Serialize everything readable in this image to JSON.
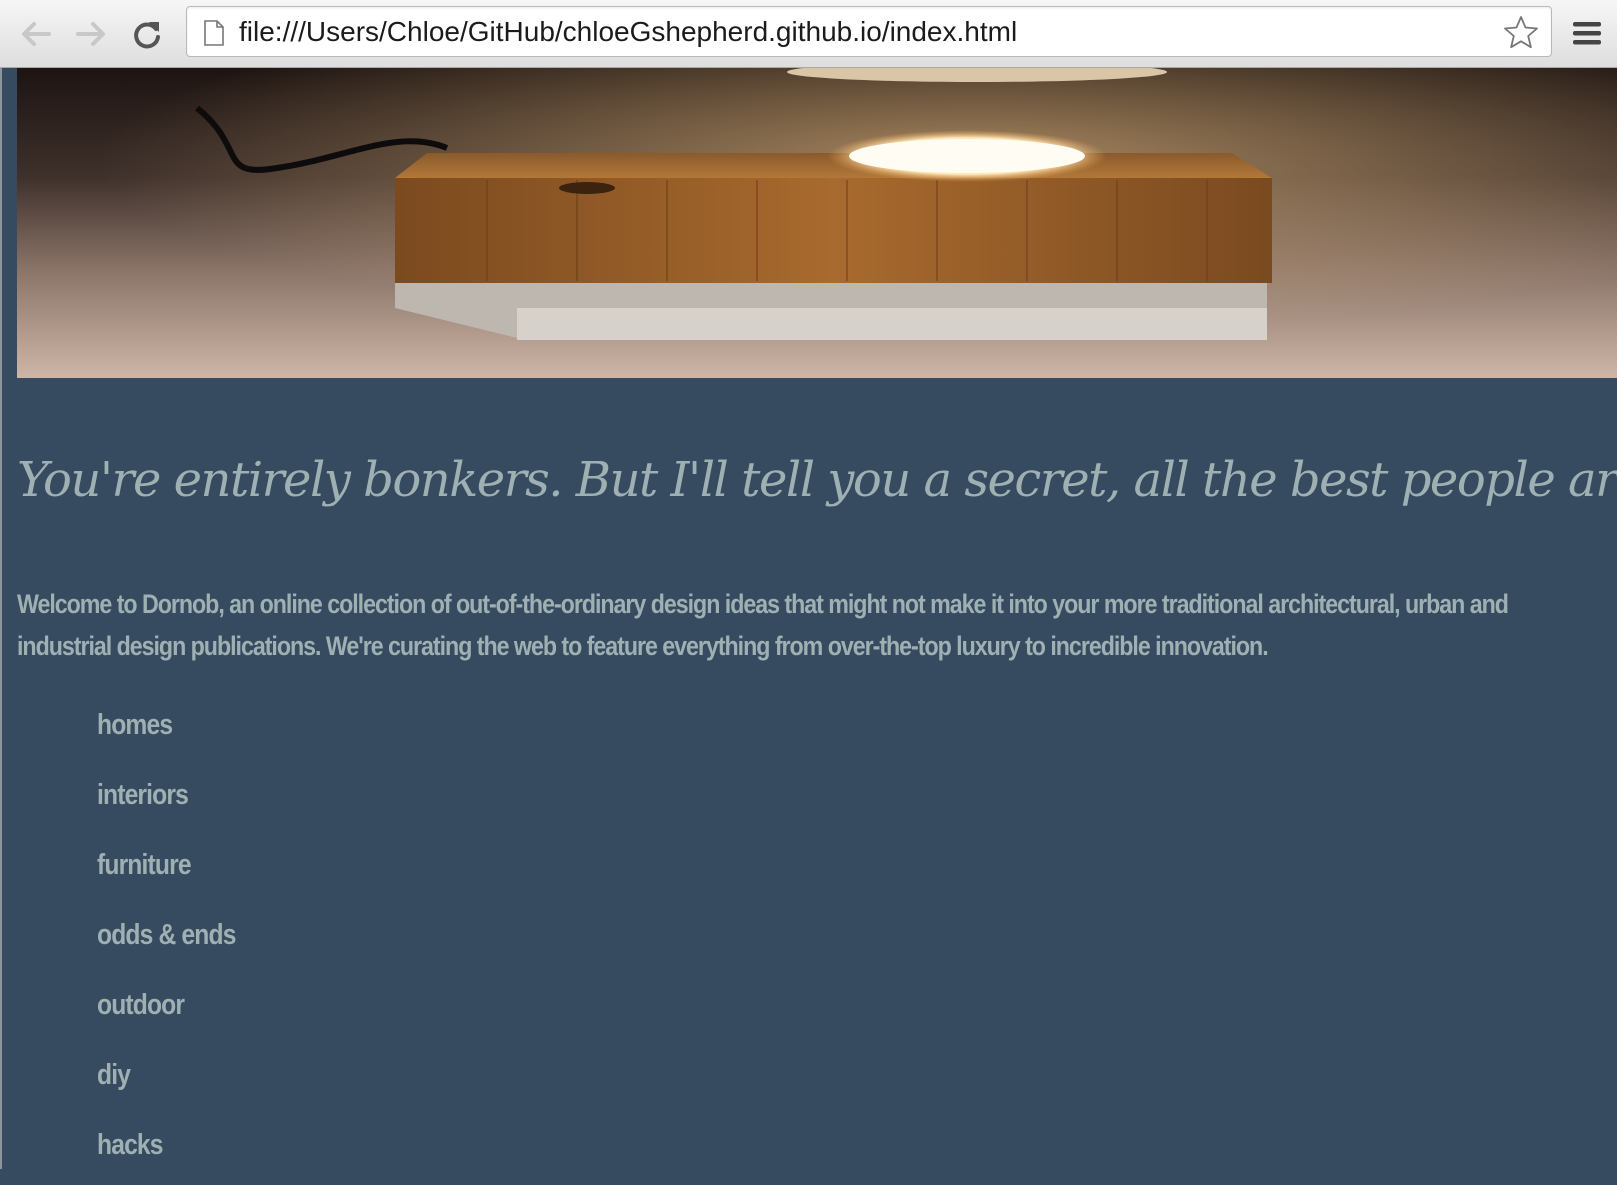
{
  "browser": {
    "url": "file:///Users/Chloe/GitHub/chloeGshepherd.github.io/index.html",
    "icons": {
      "back": "arrow-left-icon",
      "forward": "arrow-right-icon",
      "reload": "reload-icon",
      "page": "document-icon",
      "bookmark": "star-icon",
      "menu": "hamburger-menu-icon"
    }
  },
  "hero": {
    "image": "wooden levitating lamp base with glowing light"
  },
  "headline": "You're entirely bonkers. But I'll tell you a secret, all the best people are.",
  "intro": "Welcome to Dornob, an online collection of out-of-the-ordinary design ideas that might not make it into your more traditional architectural, urban and industrial design publications. We're curating the web to feature everything from over-the-top luxury to incredible innovation.",
  "nav": [
    {
      "label": "homes"
    },
    {
      "label": "interiors"
    },
    {
      "label": "furniture"
    },
    {
      "label": "odds & ends"
    },
    {
      "label": "outdoor"
    },
    {
      "label": "diy"
    },
    {
      "label": "hacks"
    }
  ],
  "colors": {
    "background": "#364a60",
    "text": "#9fb0b3"
  }
}
